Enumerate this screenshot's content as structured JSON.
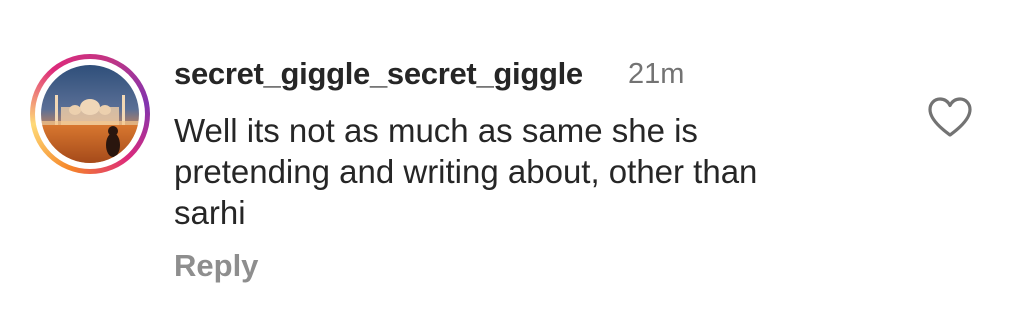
{
  "comment": {
    "username": "secret_giggle_secret_giggle",
    "timestamp": "21m",
    "text_lines": [
      "Well its not as much as same she is",
      "pretending and writing about, other than",
      "sarhi"
    ],
    "reply_label": "Reply",
    "like_icon": "heart-outline-icon",
    "avatar_ring_colors": [
      "#f58529",
      "#feda77",
      "#dd2a7b",
      "#c13584",
      "#8134af"
    ]
  }
}
